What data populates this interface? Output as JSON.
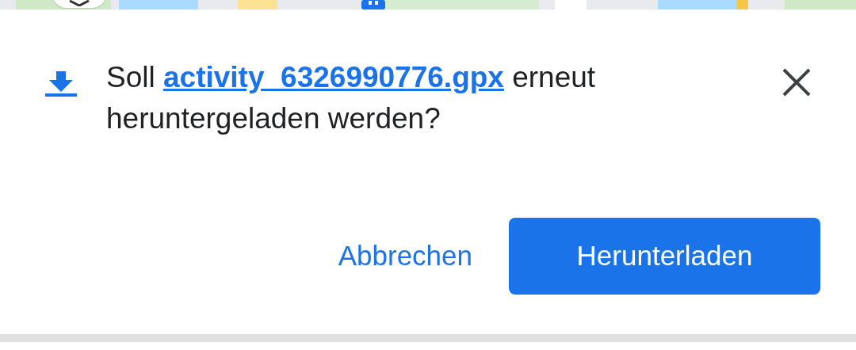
{
  "dialog": {
    "message": {
      "before": "Soll ",
      "link": "activity_6326990776.gpx",
      "after": " erneut heruntergeladen werden?"
    },
    "buttons": [
      {
        "label": "Abbrechen",
        "kind": "text"
      },
      {
        "label": "Herunterladen",
        "kind": "filled"
      }
    ]
  }
}
